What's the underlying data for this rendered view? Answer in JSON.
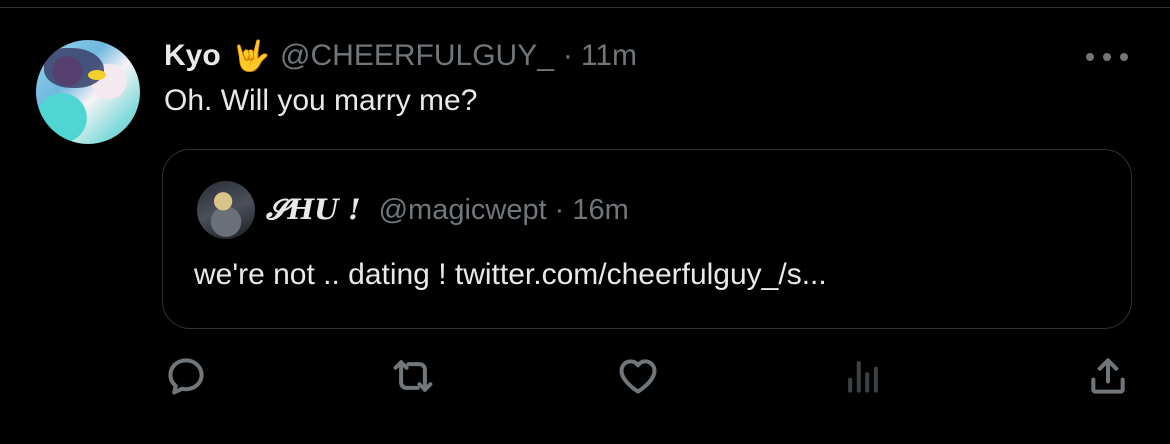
{
  "tweet": {
    "author_name": "Kyo",
    "author_emoji": "🤟",
    "author_handle": "@CHEERFULGUY_",
    "separator": "·",
    "time": "11m",
    "text": "Oh. Will you marry me?"
  },
  "quoted_tweet": {
    "author_name": "𝓢HU !",
    "author_handle": "@magicwept",
    "separator": "·",
    "time": "16m",
    "text": "we're not .. dating ! twitter.com/cheerfulguy_/s..."
  },
  "actions": {
    "icons": [
      "reply-icon",
      "retweet-icon",
      "like-icon",
      "analytics-icon",
      "share-icon"
    ]
  },
  "colors": {
    "background": "#000000",
    "primary_text": "#e7e9ea",
    "secondary_text": "#71767b",
    "border": "#2f3336"
  }
}
